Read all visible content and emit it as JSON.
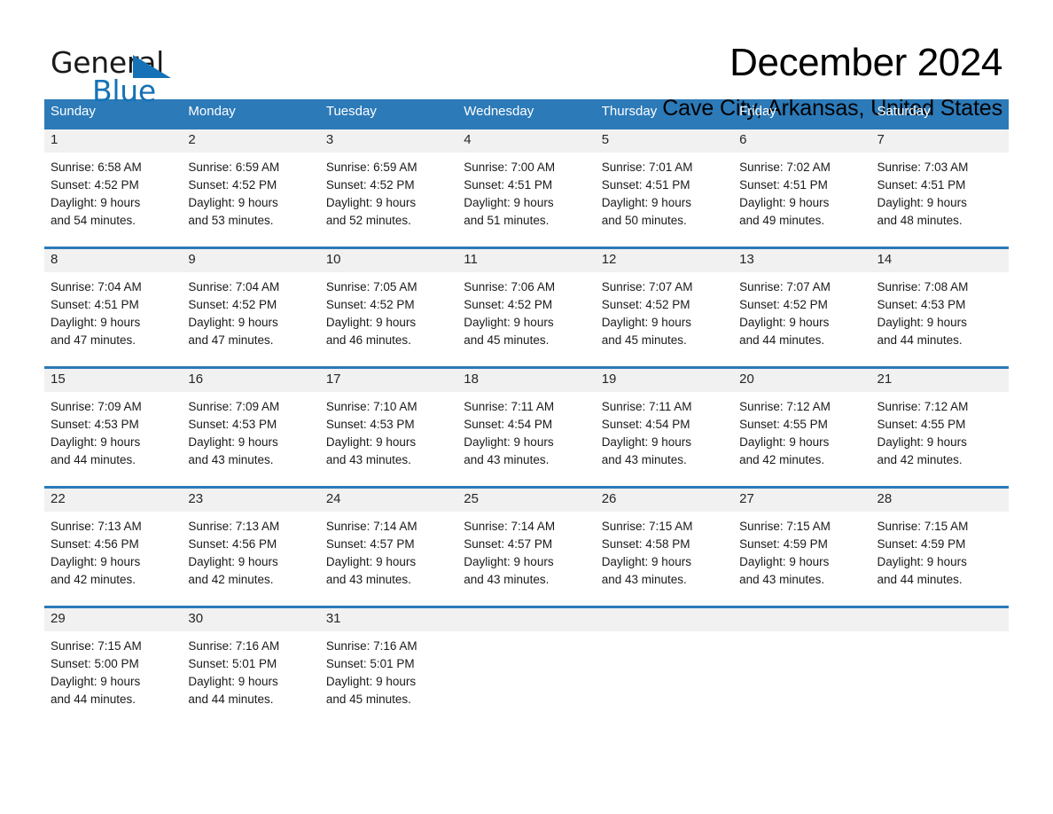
{
  "logo": {
    "part1": "General",
    "part2": "Blue",
    "triangle_color": "#1572b6"
  },
  "header": {
    "title": "December 2024",
    "location": "Cave City, Arkansas, United States"
  },
  "theme": {
    "header_blue": "#2c7ab8",
    "band_gray": "#f1f1f1",
    "text_black": "#1a1a1a"
  },
  "weekdays": [
    "Sunday",
    "Monday",
    "Tuesday",
    "Wednesday",
    "Thursday",
    "Friday",
    "Saturday"
  ],
  "weeks": [
    [
      {
        "day": "1",
        "sunrise": "Sunrise: 6:58 AM",
        "sunset": "Sunset: 4:52 PM",
        "daylight1": "Daylight: 9 hours",
        "daylight2": "and 54 minutes."
      },
      {
        "day": "2",
        "sunrise": "Sunrise: 6:59 AM",
        "sunset": "Sunset: 4:52 PM",
        "daylight1": "Daylight: 9 hours",
        "daylight2": "and 53 minutes."
      },
      {
        "day": "3",
        "sunrise": "Sunrise: 6:59 AM",
        "sunset": "Sunset: 4:52 PM",
        "daylight1": "Daylight: 9 hours",
        "daylight2": "and 52 minutes."
      },
      {
        "day": "4",
        "sunrise": "Sunrise: 7:00 AM",
        "sunset": "Sunset: 4:51 PM",
        "daylight1": "Daylight: 9 hours",
        "daylight2": "and 51 minutes."
      },
      {
        "day": "5",
        "sunrise": "Sunrise: 7:01 AM",
        "sunset": "Sunset: 4:51 PM",
        "daylight1": "Daylight: 9 hours",
        "daylight2": "and 50 minutes."
      },
      {
        "day": "6",
        "sunrise": "Sunrise: 7:02 AM",
        "sunset": "Sunset: 4:51 PM",
        "daylight1": "Daylight: 9 hours",
        "daylight2": "and 49 minutes."
      },
      {
        "day": "7",
        "sunrise": "Sunrise: 7:03 AM",
        "sunset": "Sunset: 4:51 PM",
        "daylight1": "Daylight: 9 hours",
        "daylight2": "and 48 minutes."
      }
    ],
    [
      {
        "day": "8",
        "sunrise": "Sunrise: 7:04 AM",
        "sunset": "Sunset: 4:51 PM",
        "daylight1": "Daylight: 9 hours",
        "daylight2": "and 47 minutes."
      },
      {
        "day": "9",
        "sunrise": "Sunrise: 7:04 AM",
        "sunset": "Sunset: 4:52 PM",
        "daylight1": "Daylight: 9 hours",
        "daylight2": "and 47 minutes."
      },
      {
        "day": "10",
        "sunrise": "Sunrise: 7:05 AM",
        "sunset": "Sunset: 4:52 PM",
        "daylight1": "Daylight: 9 hours",
        "daylight2": "and 46 minutes."
      },
      {
        "day": "11",
        "sunrise": "Sunrise: 7:06 AM",
        "sunset": "Sunset: 4:52 PM",
        "daylight1": "Daylight: 9 hours",
        "daylight2": "and 45 minutes."
      },
      {
        "day": "12",
        "sunrise": "Sunrise: 7:07 AM",
        "sunset": "Sunset: 4:52 PM",
        "daylight1": "Daylight: 9 hours",
        "daylight2": "and 45 minutes."
      },
      {
        "day": "13",
        "sunrise": "Sunrise: 7:07 AM",
        "sunset": "Sunset: 4:52 PM",
        "daylight1": "Daylight: 9 hours",
        "daylight2": "and 44 minutes."
      },
      {
        "day": "14",
        "sunrise": "Sunrise: 7:08 AM",
        "sunset": "Sunset: 4:53 PM",
        "daylight1": "Daylight: 9 hours",
        "daylight2": "and 44 minutes."
      }
    ],
    [
      {
        "day": "15",
        "sunrise": "Sunrise: 7:09 AM",
        "sunset": "Sunset: 4:53 PM",
        "daylight1": "Daylight: 9 hours",
        "daylight2": "and 44 minutes."
      },
      {
        "day": "16",
        "sunrise": "Sunrise: 7:09 AM",
        "sunset": "Sunset: 4:53 PM",
        "daylight1": "Daylight: 9 hours",
        "daylight2": "and 43 minutes."
      },
      {
        "day": "17",
        "sunrise": "Sunrise: 7:10 AM",
        "sunset": "Sunset: 4:53 PM",
        "daylight1": "Daylight: 9 hours",
        "daylight2": "and 43 minutes."
      },
      {
        "day": "18",
        "sunrise": "Sunrise: 7:11 AM",
        "sunset": "Sunset: 4:54 PM",
        "daylight1": "Daylight: 9 hours",
        "daylight2": "and 43 minutes."
      },
      {
        "day": "19",
        "sunrise": "Sunrise: 7:11 AM",
        "sunset": "Sunset: 4:54 PM",
        "daylight1": "Daylight: 9 hours",
        "daylight2": "and 43 minutes."
      },
      {
        "day": "20",
        "sunrise": "Sunrise: 7:12 AM",
        "sunset": "Sunset: 4:55 PM",
        "daylight1": "Daylight: 9 hours",
        "daylight2": "and 42 minutes."
      },
      {
        "day": "21",
        "sunrise": "Sunrise: 7:12 AM",
        "sunset": "Sunset: 4:55 PM",
        "daylight1": "Daylight: 9 hours",
        "daylight2": "and 42 minutes."
      }
    ],
    [
      {
        "day": "22",
        "sunrise": "Sunrise: 7:13 AM",
        "sunset": "Sunset: 4:56 PM",
        "daylight1": "Daylight: 9 hours",
        "daylight2": "and 42 minutes."
      },
      {
        "day": "23",
        "sunrise": "Sunrise: 7:13 AM",
        "sunset": "Sunset: 4:56 PM",
        "daylight1": "Daylight: 9 hours",
        "daylight2": "and 42 minutes."
      },
      {
        "day": "24",
        "sunrise": "Sunrise: 7:14 AM",
        "sunset": "Sunset: 4:57 PM",
        "daylight1": "Daylight: 9 hours",
        "daylight2": "and 43 minutes."
      },
      {
        "day": "25",
        "sunrise": "Sunrise: 7:14 AM",
        "sunset": "Sunset: 4:57 PM",
        "daylight1": "Daylight: 9 hours",
        "daylight2": "and 43 minutes."
      },
      {
        "day": "26",
        "sunrise": "Sunrise: 7:15 AM",
        "sunset": "Sunset: 4:58 PM",
        "daylight1": "Daylight: 9 hours",
        "daylight2": "and 43 minutes."
      },
      {
        "day": "27",
        "sunrise": "Sunrise: 7:15 AM",
        "sunset": "Sunset: 4:59 PM",
        "daylight1": "Daylight: 9 hours",
        "daylight2": "and 43 minutes."
      },
      {
        "day": "28",
        "sunrise": "Sunrise: 7:15 AM",
        "sunset": "Sunset: 4:59 PM",
        "daylight1": "Daylight: 9 hours",
        "daylight2": "and 44 minutes."
      }
    ],
    [
      {
        "day": "29",
        "sunrise": "Sunrise: 7:15 AM",
        "sunset": "Sunset: 5:00 PM",
        "daylight1": "Daylight: 9 hours",
        "daylight2": "and 44 minutes."
      },
      {
        "day": "30",
        "sunrise": "Sunrise: 7:16 AM",
        "sunset": "Sunset: 5:01 PM",
        "daylight1": "Daylight: 9 hours",
        "daylight2": "and 44 minutes."
      },
      {
        "day": "31",
        "sunrise": "Sunrise: 7:16 AM",
        "sunset": "Sunset: 5:01 PM",
        "daylight1": "Daylight: 9 hours",
        "daylight2": "and 45 minutes."
      },
      {
        "day": "",
        "sunrise": "",
        "sunset": "",
        "daylight1": "",
        "daylight2": "",
        "empty": true
      },
      {
        "day": "",
        "sunrise": "",
        "sunset": "",
        "daylight1": "",
        "daylight2": "",
        "empty": true
      },
      {
        "day": "",
        "sunrise": "",
        "sunset": "",
        "daylight1": "",
        "daylight2": "",
        "empty": true
      },
      {
        "day": "",
        "sunrise": "",
        "sunset": "",
        "daylight1": "",
        "daylight2": "",
        "empty": true
      }
    ]
  ]
}
